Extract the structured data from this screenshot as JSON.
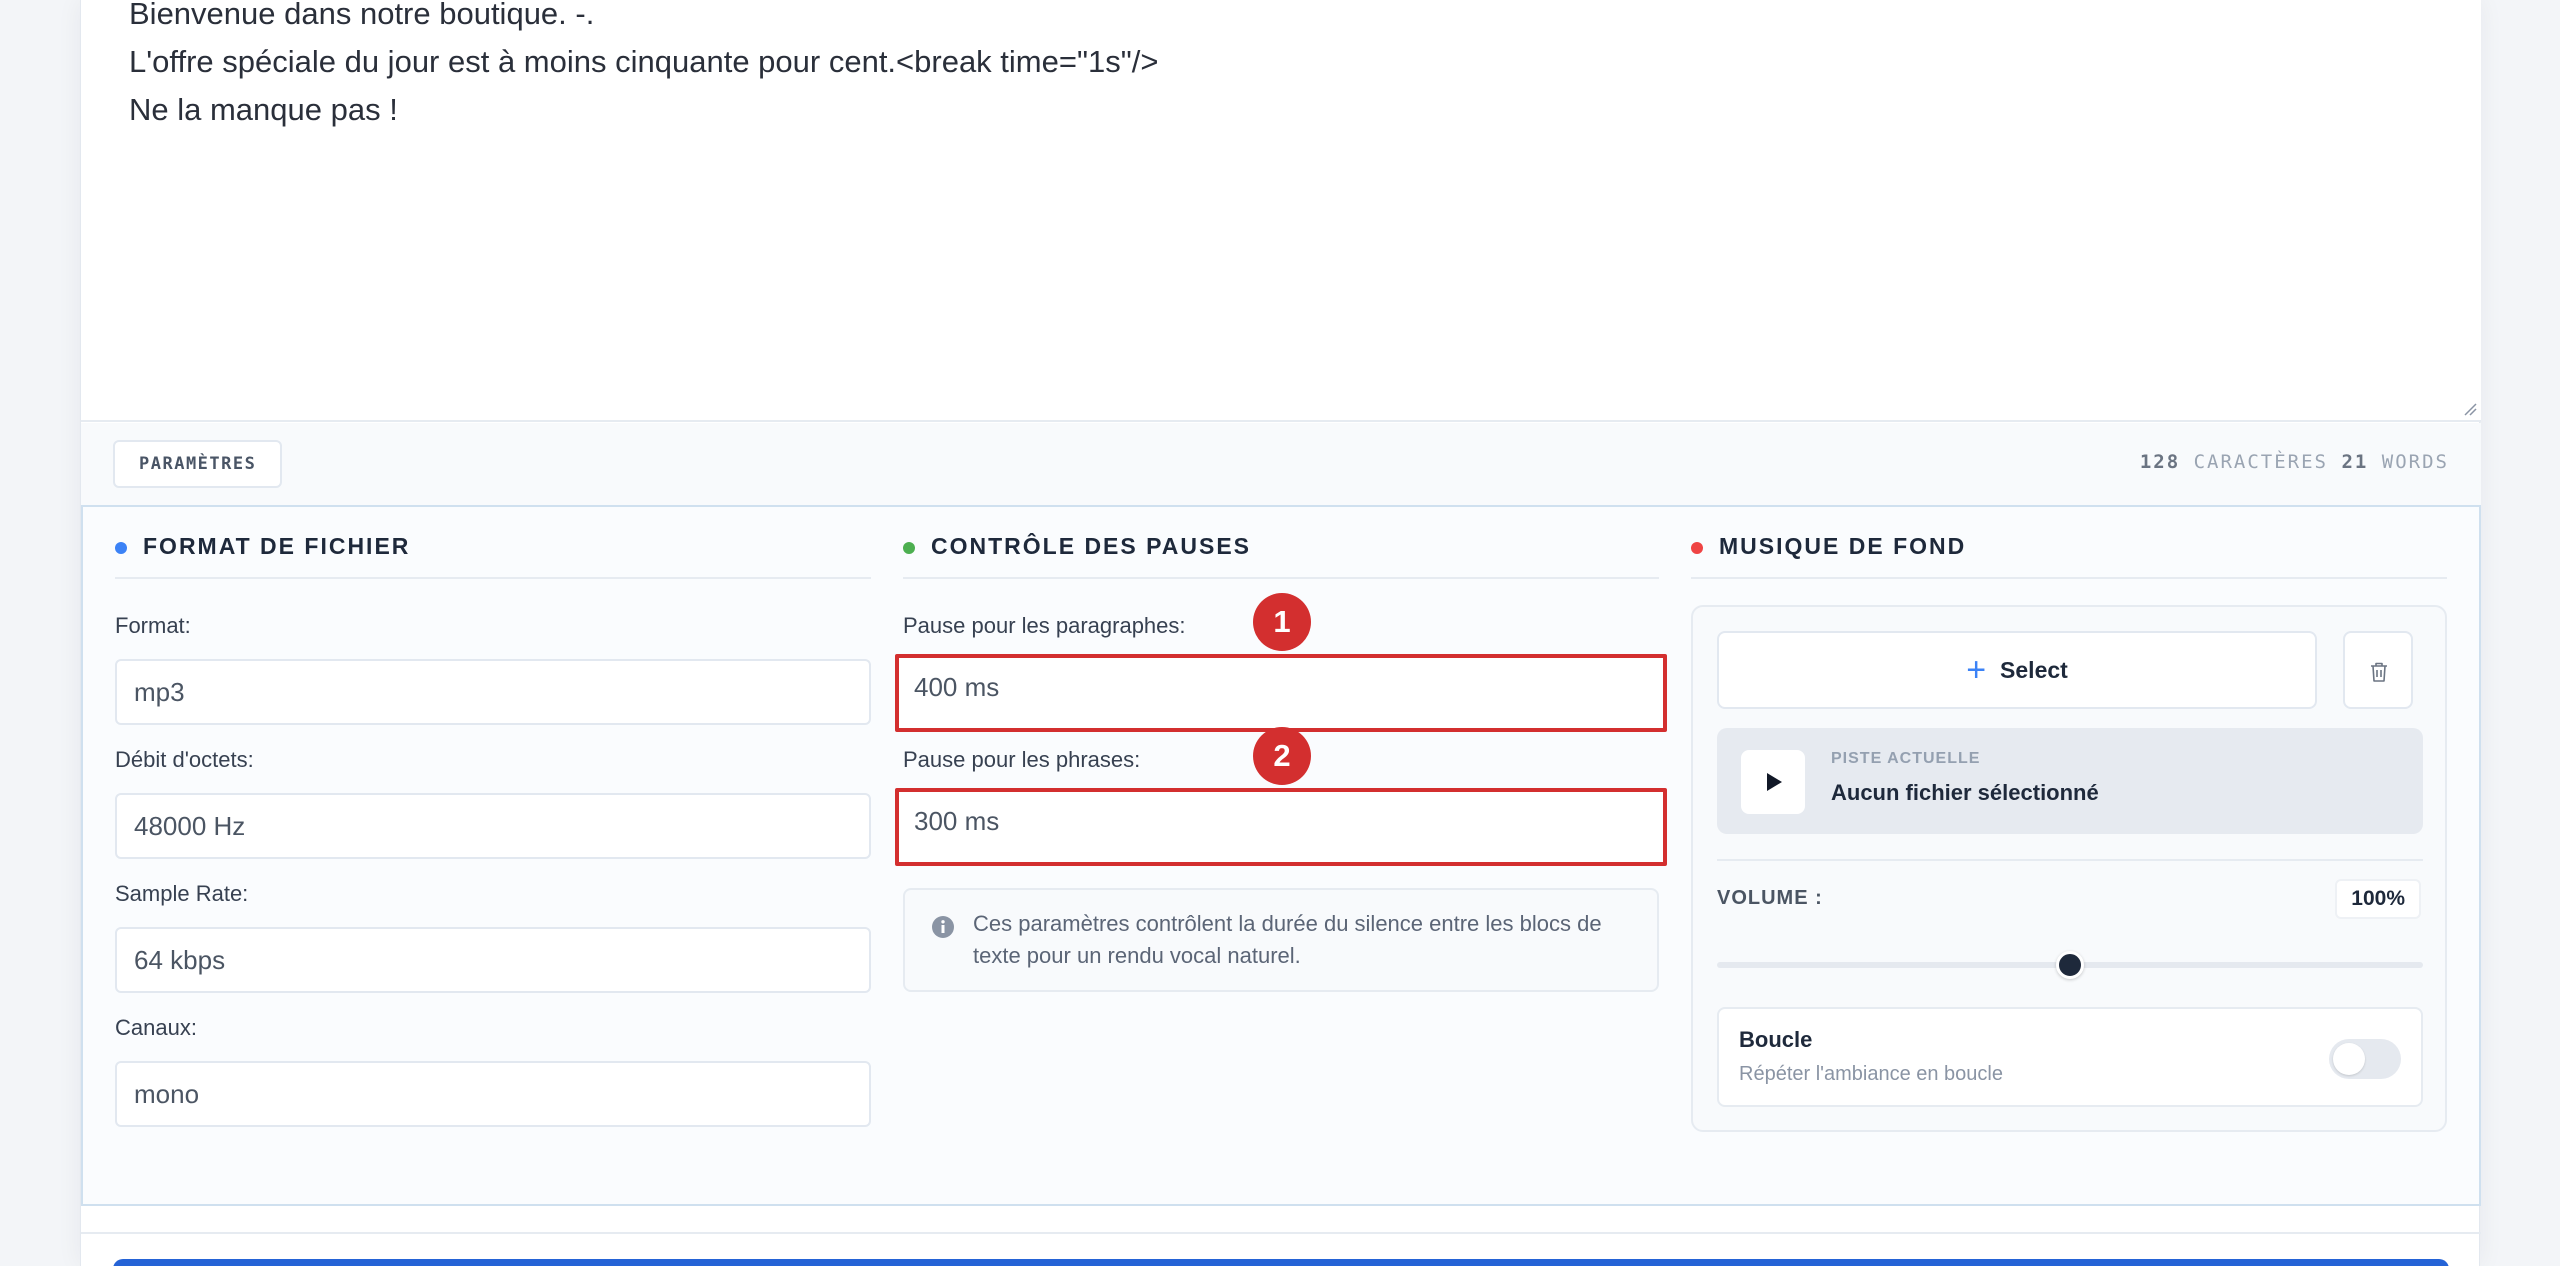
{
  "editor": {
    "lines": [
      "Bienvenue dans notre boutique. -.",
      "L'offre spéciale du jour est à moins cinquante pour cent.<break time=\"1s\"/>",
      "Ne la manque pas !"
    ]
  },
  "toolbar": {
    "params_label": "PARAMÈTRES",
    "char_count": "128",
    "char_label": "CARACTÈRES",
    "word_count": "21",
    "word_label": "WORDS"
  },
  "file_format": {
    "title": "FORMAT DE FICHIER",
    "dot_color": "#3b82f6",
    "fields": [
      {
        "label": "Format:",
        "value": "mp3"
      },
      {
        "label": "Débit d'octets:",
        "value": "48000 Hz"
      },
      {
        "label": "Sample Rate:",
        "value": "64 kbps"
      },
      {
        "label": "Canaux:",
        "value": "mono"
      }
    ]
  },
  "pauses": {
    "title": "CONTRÔLE DES PAUSES",
    "dot_color": "#4caf50",
    "paragraph_label": "Pause pour les paragraphes:",
    "paragraph_value": "400 ms",
    "sentence_label": "Pause pour les phrases:",
    "sentence_value": "300 ms",
    "badge_1": "1",
    "badge_2": "2",
    "highlight_color": "#d32f2f",
    "info_text": "Ces paramètres contrôlent la durée du silence entre les blocs de texte pour un rendu vocal naturel."
  },
  "music": {
    "title": "MUSIQUE DE FOND",
    "dot_color": "#ef4444",
    "select_label": "Select",
    "track_kicker": "PISTE ACTUELLE",
    "track_name": "Aucun fichier sélectionné",
    "volume_label": "VOLUME :",
    "volume_value": "100%",
    "slider_fraction": 0.5,
    "loop_title": "Boucle",
    "loop_subtitle": "Répéter l'ambiance en boucle",
    "loop_enabled": false
  },
  "colors": {
    "accent_blue": "#2563d6"
  }
}
